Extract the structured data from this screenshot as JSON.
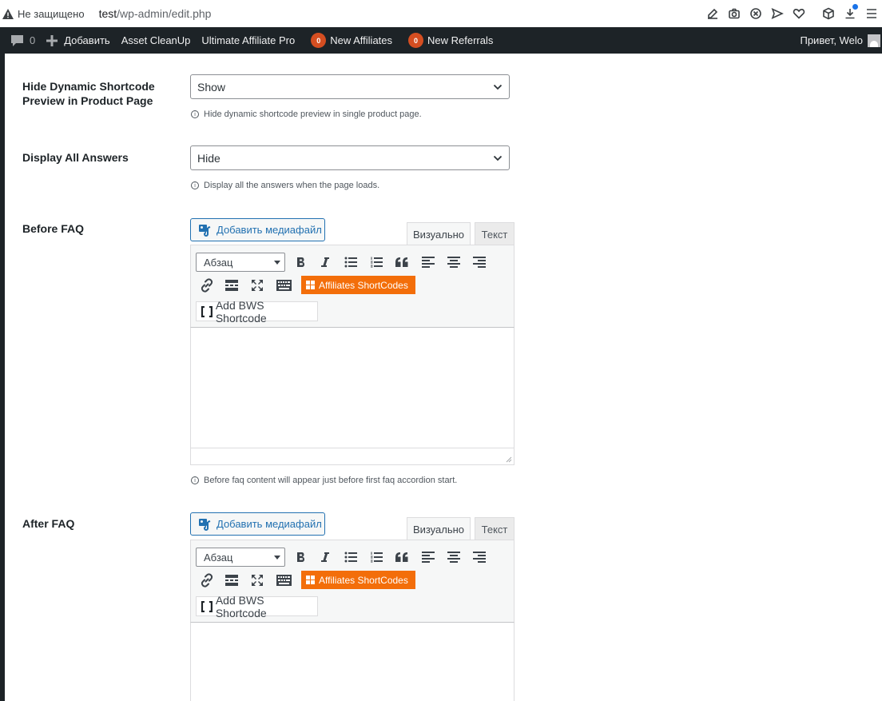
{
  "browser": {
    "security_label": "Не защищено",
    "url_host": "test",
    "url_path": "/wp-admin/edit.php"
  },
  "adminbar": {
    "comments_count": "0",
    "add_label": "Добавить",
    "asset_cleanup": "Asset CleanUp",
    "ultimate_affiliate": "Ultimate Affiliate Pro",
    "new_affiliates_count": "0",
    "new_affiliates_label": "New Affiliates",
    "new_referrals_count": "0",
    "new_referrals_label": "New Referrals",
    "greeting": "Привет, Welo"
  },
  "fields": {
    "hide_preview": {
      "label": "Hide Dynamic Shortcode Preview in Product Page",
      "value": "Show",
      "description": "Hide dynamic shortcode preview in single product page."
    },
    "display_answers": {
      "label": "Display All Answers",
      "value": "Hide",
      "description": "Display all the answers when the page loads."
    },
    "before_faq": {
      "label": "Before FAQ",
      "description": "Before faq content will appear just before first faq accordion start."
    },
    "after_faq": {
      "label": "After FAQ"
    }
  },
  "editor": {
    "media_button": "Добавить медиафайл",
    "tab_visual": "Визуально",
    "tab_text": "Текст",
    "format_select": "Абзац",
    "affiliates_button": "Affiliates ShortCodes",
    "bws_button": "Add BWS Shortcode"
  }
}
